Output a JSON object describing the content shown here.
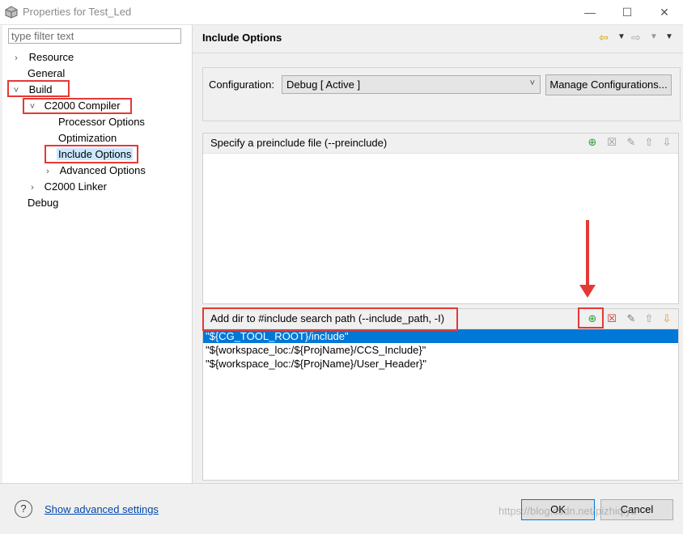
{
  "window": {
    "title": "Properties for Test_Led"
  },
  "filter": {
    "placeholder": "type filter text"
  },
  "tree": {
    "resource": "Resource",
    "general": "General",
    "build": "Build",
    "compiler": "C2000 Compiler",
    "processor": "Processor Options",
    "optimization": "Optimization",
    "include": "Include Options",
    "advanced": "Advanced Options",
    "linker": "C2000 Linker",
    "debug": "Debug"
  },
  "page": {
    "title": "Include Options"
  },
  "config": {
    "label": "Configuration:",
    "value": "Debug  [ Active ]",
    "manage_label": "Manage Configurations..."
  },
  "preinclude": {
    "header": "Specify a preinclude file (--preinclude)",
    "items": []
  },
  "include_paths": {
    "header": "Add dir to #include search path (--include_path, -I)",
    "items": [
      "\"${CG_TOOL_ROOT}/include\"",
      "\"${workspace_loc:/${ProjName}/CCS_Include}\"",
      "\"${workspace_loc:/${ProjName}/User_Header}\""
    ]
  },
  "footer": {
    "advanced_link": "Show advanced settings",
    "ok_label": "OK",
    "cancel_label": "Cancel"
  },
  "watermark": "https://blog.csdn.net/pizhiqiyu",
  "colors": {
    "selection": "#0078d7",
    "annotation": "#e53935",
    "tree_selection": "#cce8ff"
  },
  "icons": [
    "eclipse-app-icon",
    "minimize-icon",
    "maximize-icon",
    "close-icon",
    "back-arrow-icon",
    "forward-arrow-icon",
    "menu-icon",
    "add-icon",
    "delete-icon",
    "edit-icon",
    "move-up-icon",
    "move-down-icon",
    "help-icon"
  ]
}
